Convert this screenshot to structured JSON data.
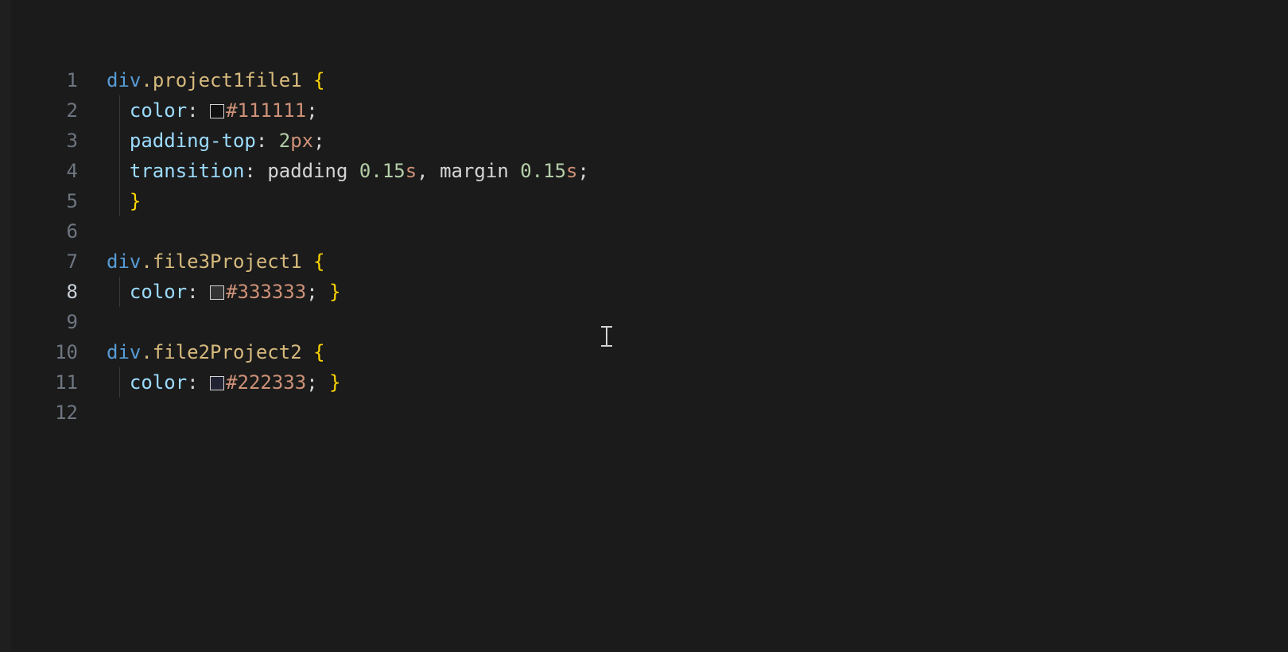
{
  "editor": {
    "active_line": 8,
    "gutter": [
      "1",
      "2",
      "3",
      "4",
      "5",
      "6",
      "7",
      "8",
      "9",
      "10",
      "11",
      "12"
    ],
    "code": {
      "line1": {
        "tag": "div",
        "dot": ".",
        "cls": "project1file1",
        "sp": " ",
        "brace": "{"
      },
      "line2": {
        "indent": "  ",
        "prop": "color",
        "colon": ":",
        "sp": " ",
        "hex": "#111111",
        "semi": ";"
      },
      "line3": {
        "indent": "  ",
        "prop": "padding-top",
        "colon": ":",
        "sp": " ",
        "num": "2",
        "unit": "px",
        "semi": ";"
      },
      "line4": {
        "indent": "  ",
        "prop": "transition",
        "colon": ":",
        "sp": " ",
        "v1": "padding",
        "sp2": " ",
        "n1": "0.15",
        "u1": "s",
        "comma": ",",
        "sp3": " ",
        "v2": "margin",
        "sp4": " ",
        "n2": "0.15",
        "u2": "s",
        "semi": ";"
      },
      "line5": {
        "indent": "  ",
        "brace": "}"
      },
      "line7": {
        "tag": "div",
        "dot": ".",
        "cls": "file3Project1",
        "sp": " ",
        "brace": "{"
      },
      "line8": {
        "indent": "  ",
        "prop": "color",
        "colon": ":",
        "sp": " ",
        "hex": "#333333",
        "semi": ";",
        "sp2": " ",
        "brace": "}"
      },
      "line10": {
        "tag": "div",
        "dot": ".",
        "cls": "file2Project2",
        "sp": " ",
        "brace": "{"
      },
      "line11": {
        "indent": "  ",
        "prop": "color",
        "colon": ":",
        "sp": " ",
        "hex": "#222333",
        "semi": ";",
        "sp2": " ",
        "brace": "}"
      }
    },
    "swatches": {
      "line2": "#111111",
      "line8": "#333333",
      "line11": "#222333"
    }
  }
}
